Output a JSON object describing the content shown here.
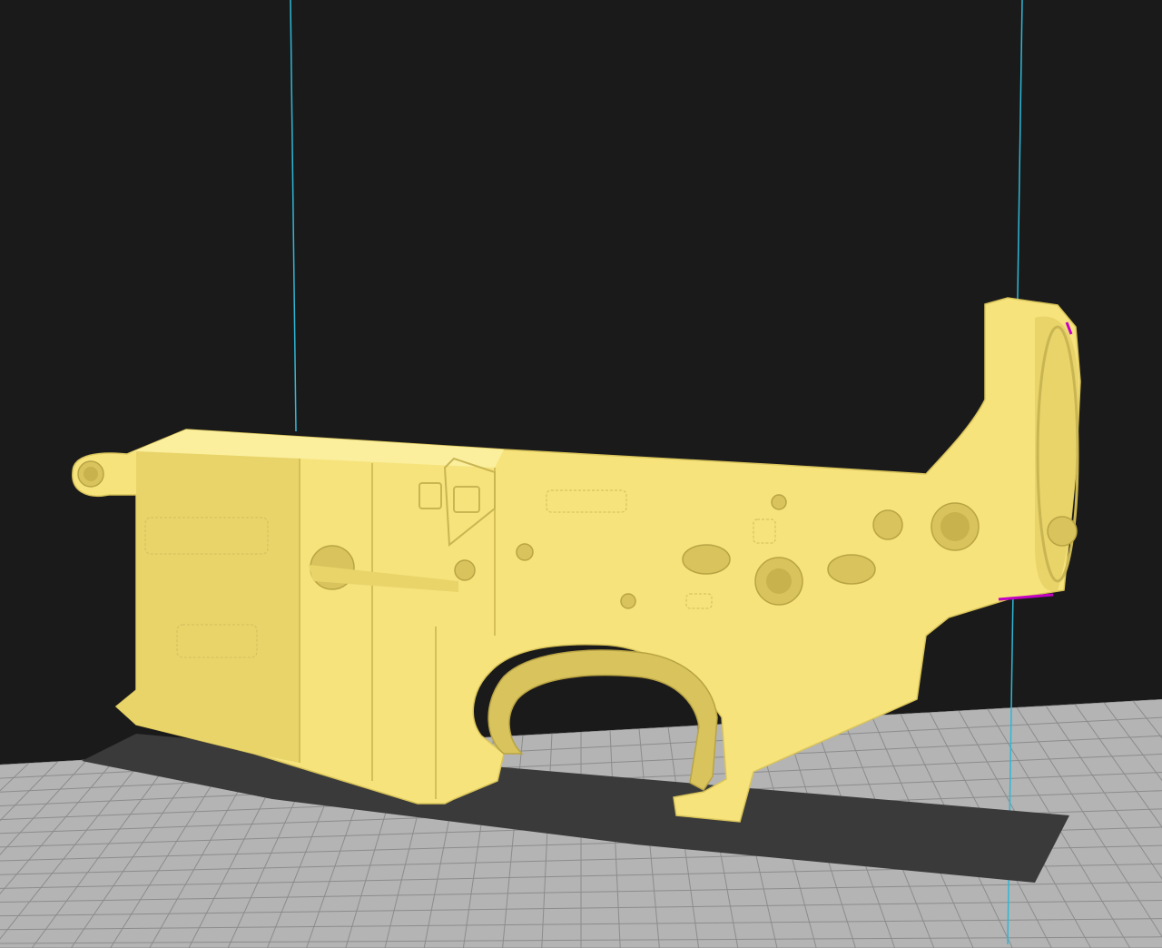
{
  "app": {
    "title": ""
  },
  "viewport": {
    "background_color": "#1a1a1a",
    "build_plate_color": "#b4b4b4",
    "grid_line_color": "#8c8c8c",
    "shadow_color": "#3a3a3a",
    "volume_edge_color": "#2fb7d6",
    "model_color": "#f6e37c",
    "model_shade_color": "#e9d46a",
    "model_highlight_color": "#fbef9e",
    "overhang_color": "#c400c4",
    "model": {
      "name": "",
      "engravings": [
        "",
        "",
        "",
        "",
        ""
      ]
    }
  }
}
